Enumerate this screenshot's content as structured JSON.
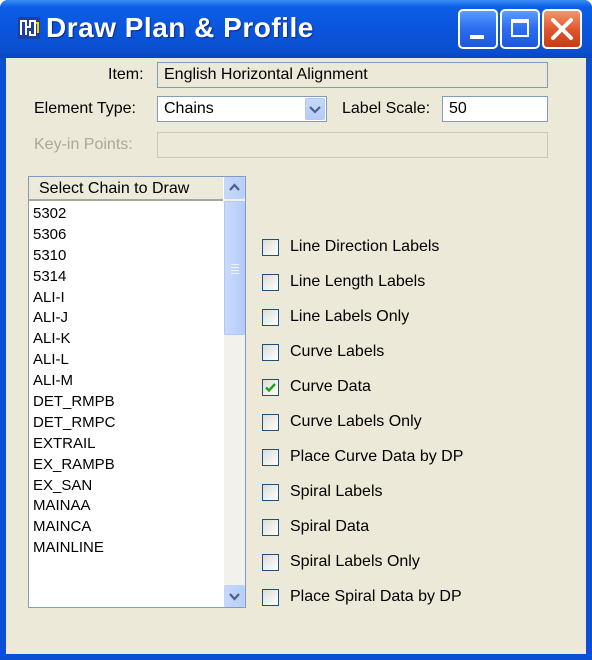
{
  "window": {
    "title": "Draw Plan & Profile",
    "icon": "app-logo-icon",
    "controls": [
      "minimize-icon",
      "maximize-icon",
      "close-icon"
    ]
  },
  "form": {
    "item_label": "Item:",
    "item_value": "English Horizontal Alignment",
    "element_type_label": "Element Type:",
    "element_type_value": "Chains",
    "label_scale_label": "Label Scale:",
    "label_scale_value": "50",
    "keyin_points_label": "Key-in Points:",
    "keyin_points_value": ""
  },
  "chain_list": {
    "header": "Select Chain to Draw",
    "items": [
      "5302",
      "5306",
      "5310",
      "5314",
      "ALI-I",
      "ALI-J",
      "ALI-K",
      "ALI-L",
      "ALI-M",
      "DET_RMPB",
      "DET_RMPC",
      "EXTRAIL",
      "EX_RAMPB",
      "EX_SAN",
      "MAINAA",
      "MAINCA",
      "MAINLINE"
    ]
  },
  "options": [
    {
      "label": "Line Direction Labels",
      "checked": false
    },
    {
      "label": "Line Length Labels",
      "checked": false
    },
    {
      "label": "Line Labels Only",
      "checked": false
    },
    {
      "label": "Curve Labels",
      "checked": false
    },
    {
      "label": "Curve Data",
      "checked": true
    },
    {
      "label": "Curve Labels Only",
      "checked": false
    },
    {
      "label": "Place Curve Data by DP",
      "checked": false
    },
    {
      "label": "Spiral Labels",
      "checked": false
    },
    {
      "label": "Spiral Data",
      "checked": false
    },
    {
      "label": "Spiral Labels Only",
      "checked": false
    },
    {
      "label": "Place Spiral Data by DP",
      "checked": false
    }
  ],
  "colors": {
    "titlebar": "#0a55dc",
    "client_bg": "#ece9d8",
    "check_mark": "#21a121"
  }
}
